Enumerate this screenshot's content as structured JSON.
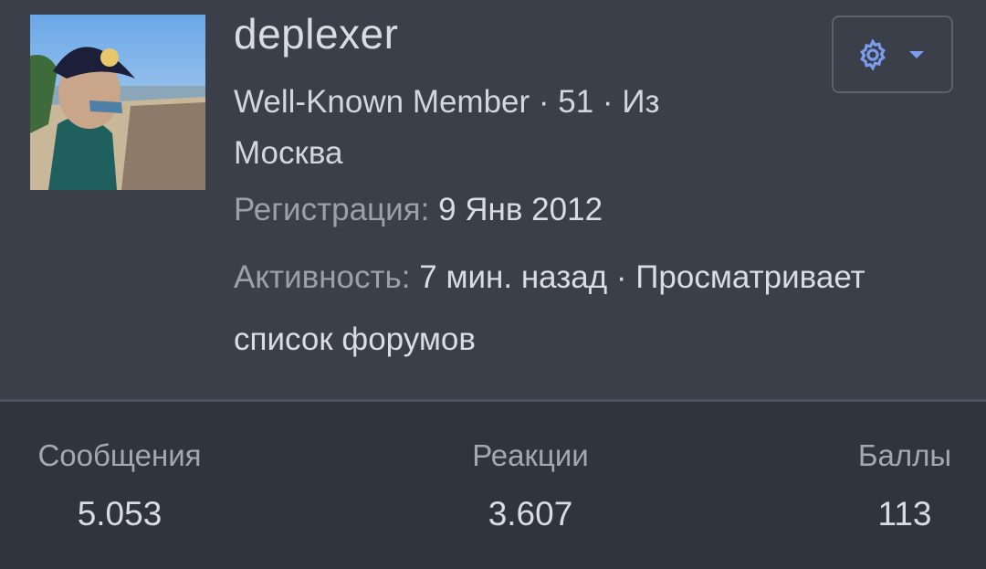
{
  "profile": {
    "username": "deplexer",
    "title_line": "Well-Known Member · 51 · Из Москва",
    "registration_label": "Регистрация:",
    "registration_value": "9 Янв 2012",
    "activity_label": "Активность:",
    "activity_value": "7 мин. назад · Просматривает список форумов",
    "avatar": "user-avatar-photo"
  },
  "actions": {
    "settings_icon": "gear-icon",
    "dropdown_icon": "caret-down-icon",
    "accent_color": "#7c9cf0"
  },
  "stats": [
    {
      "label": "Сообщения",
      "value": "5.053"
    },
    {
      "label": "Реакции",
      "value": "3.607"
    },
    {
      "label": "Баллы",
      "value": "113"
    }
  ]
}
